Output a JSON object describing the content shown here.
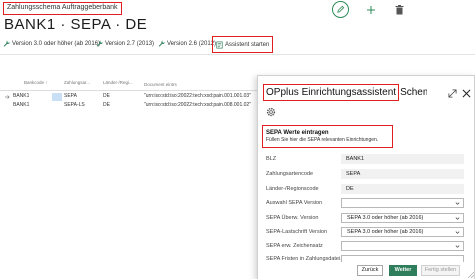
{
  "top_label": "Zahlungsschema Auftraggeberbank",
  "page_title": "BANK1 · SEPA · DE",
  "actions": [
    {
      "label": "Version 3.0 oder höher (ab 2016)"
    },
    {
      "label": "Version 2.7 (2013)"
    },
    {
      "label": "Version 2.6 (2012)"
    },
    {
      "label": "Assistent starten"
    }
  ],
  "grid": {
    "columns": [
      "Bankcode ↑",
      "Zahlungsar...",
      "Länder-/Regi...",
      "Document eintrs"
    ],
    "rows": [
      {
        "bank": "BANK1",
        "type": "SEPA",
        "region": "DE",
        "doc": "\"urn:iso:std:iso:20022:tech:xsd:pain.001.001.03\""
      },
      {
        "bank": "BANK1",
        "type": "SEPA-LS",
        "region": "DE",
        "doc": "\"urn:iso:std:iso:20022:tech:xsd:pain.008.001.02\""
      }
    ]
  },
  "dialog": {
    "title_highlight": "OPplus Einrichtungsassistent",
    "title_rest": "Schema Auftragg...",
    "info_title": "SEPA Werte eintragen",
    "info_text": "Füllen Sie hier die SEPA relevanten Einrichtungen.",
    "fields": [
      {
        "label": "BLZ",
        "value": "BANK1"
      },
      {
        "label": "Zahlungsartencode",
        "value": "SEPA"
      },
      {
        "label": "Länder-/Regionscode",
        "value": "DE"
      },
      {
        "label": "Auswahl SEPA Version",
        "value": ""
      },
      {
        "label": "SEPA Überw. Version",
        "value": "SEPA 3.0 oder höher (ab 2016)"
      },
      {
        "label": "SEPA-Lastschrift Version",
        "value": "SEPA 3.0 oder höher (ab 2016)"
      },
      {
        "label": "SEPA erw. Zeichensatz",
        "value": ""
      },
      {
        "label": "SEPA Fristen in Zahlungsdatei...",
        "value": ""
      }
    ],
    "buttons": {
      "back": "Zurück",
      "next": "Weiter",
      "finish": "Fertig stellen"
    }
  },
  "colors": {
    "highlight": "#e02020",
    "accent": "#2e7d5b",
    "selection": "#c9dff5"
  }
}
